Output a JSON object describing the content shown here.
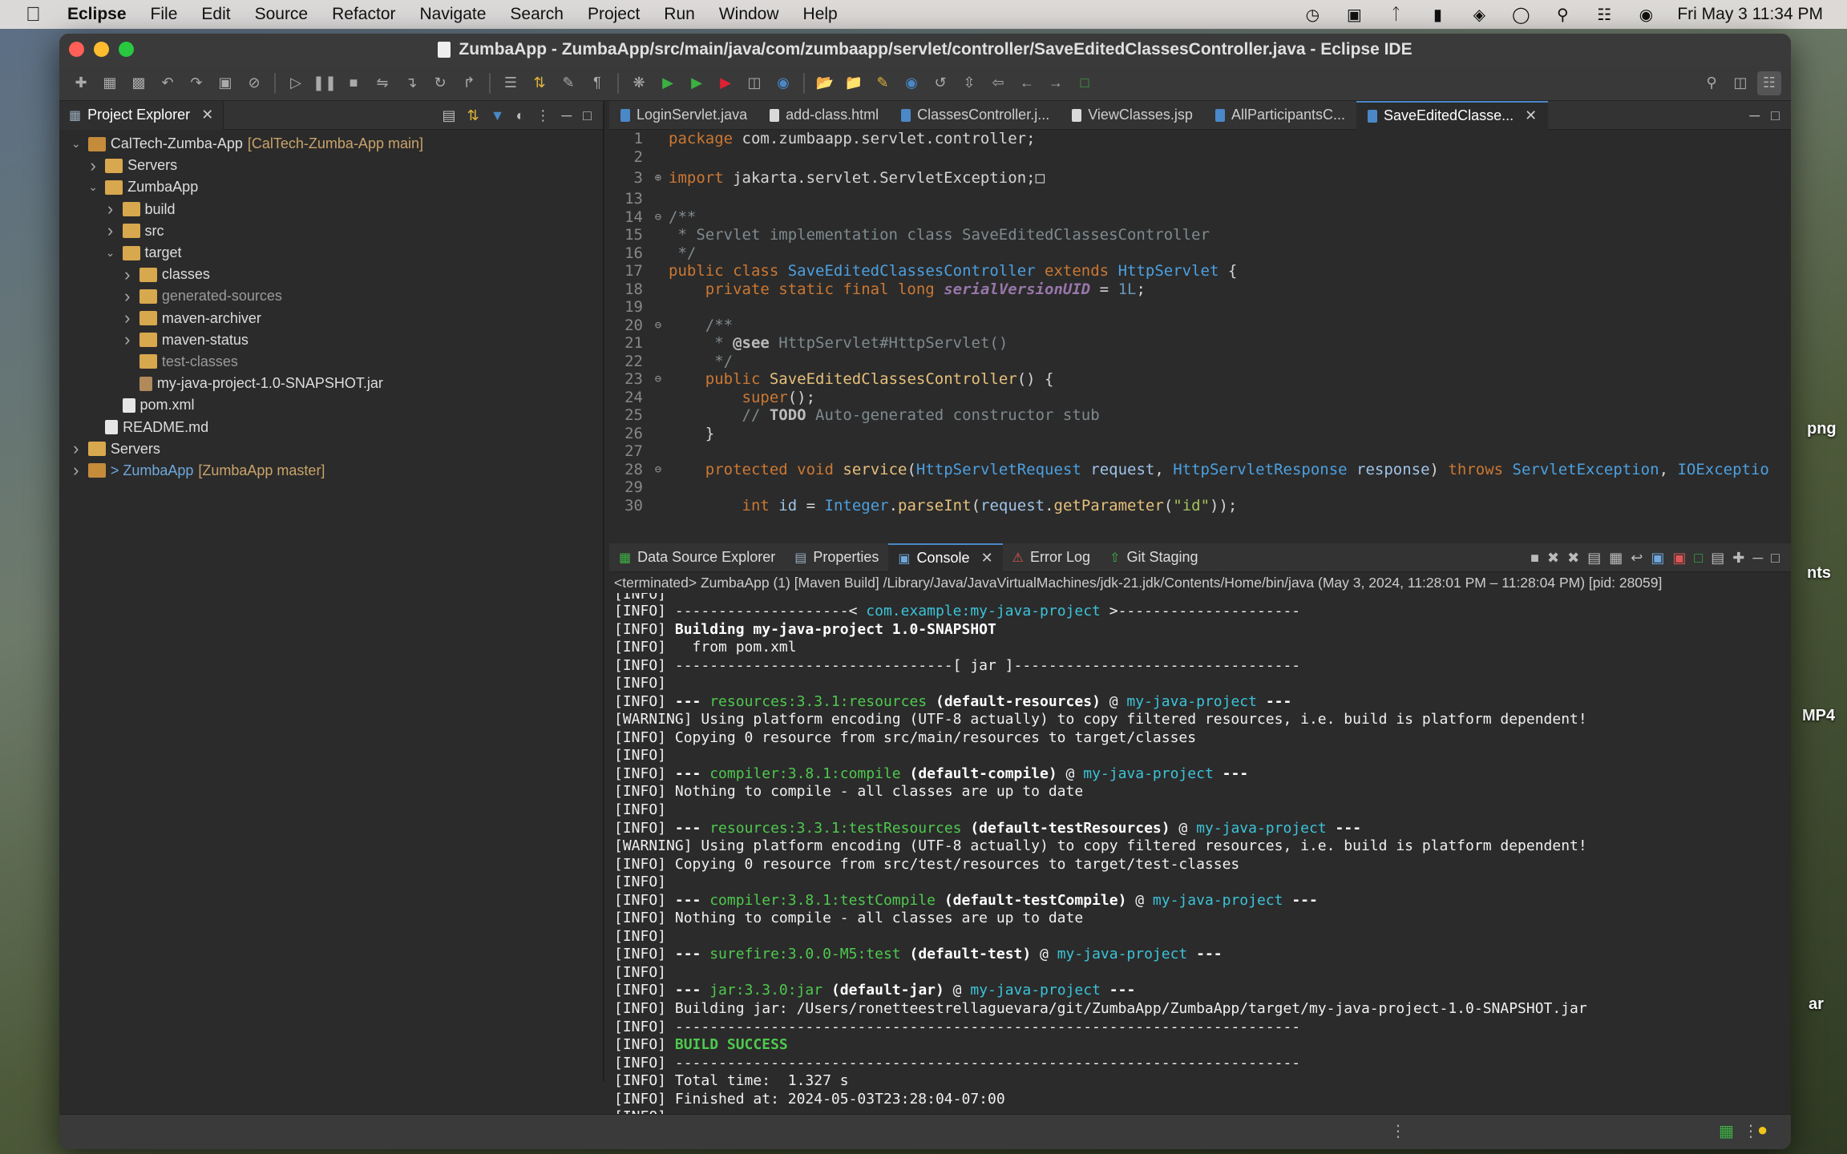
{
  "menubar": {
    "app_name": "Eclipse",
    "items": [
      "File",
      "Edit",
      "Source",
      "Refactor",
      "Navigate",
      "Search",
      "Project",
      "Run",
      "Window",
      "Help"
    ],
    "datetime": "Fri May 3  11:34 PM"
  },
  "desktop_labels": [
    "png",
    "nts",
    "MP4",
    "ar"
  ],
  "window": {
    "title": "ZumbaApp - ZumbaApp/src/main/java/com/zumbaapp/servlet/controller/SaveEditedClassesController.java - Eclipse IDE"
  },
  "explorer": {
    "tab_label": "Project Explorer",
    "tree": [
      {
        "label": "CalTech-Zumba-App",
        "deco": "[CalTech-Zumba-App main]",
        "indent": 0,
        "chevron": "down",
        "icon": "project"
      },
      {
        "label": "Servers",
        "indent": 1,
        "chevron": "right",
        "icon": "folder"
      },
      {
        "label": "ZumbaApp",
        "indent": 1,
        "chevron": "down",
        "icon": "folder"
      },
      {
        "label": "build",
        "indent": 2,
        "chevron": "right",
        "icon": "folder"
      },
      {
        "label": "src",
        "indent": 2,
        "chevron": "right",
        "icon": "folder"
      },
      {
        "label": "target",
        "indent": 2,
        "chevron": "down",
        "icon": "folder"
      },
      {
        "label": "classes",
        "indent": 3,
        "chevron": "right",
        "icon": "folder"
      },
      {
        "label": "generated-sources",
        "indent": 3,
        "chevron": "right",
        "icon": "folder",
        "muted": true
      },
      {
        "label": "maven-archiver",
        "indent": 3,
        "chevron": "right",
        "icon": "folder"
      },
      {
        "label": "maven-status",
        "indent": 3,
        "chevron": "right",
        "icon": "folder"
      },
      {
        "label": "test-classes",
        "indent": 3,
        "chevron": "none",
        "icon": "folder",
        "muted": true
      },
      {
        "label": "my-java-project-1.0-SNAPSHOT.jar",
        "indent": 3,
        "chevron": "none",
        "icon": "jar"
      },
      {
        "label": "pom.xml",
        "indent": 2,
        "chevron": "none",
        "icon": "file"
      },
      {
        "label": "README.md",
        "indent": 1,
        "chevron": "none",
        "icon": "file"
      },
      {
        "label": "Servers",
        "indent": 0,
        "chevron": "right",
        "icon": "folder"
      },
      {
        "label": "> ZumbaApp",
        "deco": "[ZumbaApp master]",
        "indent": 0,
        "chevron": "right",
        "icon": "project",
        "blue": true
      }
    ]
  },
  "editor": {
    "tabs": [
      "LoginServlet.java",
      "add-class.html",
      "ClassesController.j...",
      "ViewClasses.jsp",
      "AllParticipantsC...",
      "SaveEditedClasse..."
    ],
    "active_tab": 5,
    "line_numbers": [
      "1",
      "2",
      "3",
      "13",
      "14",
      "15",
      "16",
      "17",
      "18",
      "19",
      "20",
      "21",
      "22",
      "23",
      "24",
      "25",
      "26",
      "27",
      "28",
      "29",
      "30"
    ]
  },
  "console": {
    "tabs": [
      "Data Source Explorer",
      "Properties",
      "Console",
      "Error Log",
      "Git Staging"
    ],
    "active_tab": 2,
    "terminated": "<terminated> ZumbaApp (1) [Maven Build] /Library/Java/JavaVirtualMachines/jdk-21.jdk/Contents/Home/bin/java  (May 3, 2024, 11:28:01 PM – 11:28:04 PM) [pid: 28059]"
  },
  "colors": {
    "keyword": "#cc7832",
    "class": "#4ca0e0",
    "comment": "#7f8a8f",
    "success": "#4ec94e",
    "link": "#3bc3d8"
  }
}
